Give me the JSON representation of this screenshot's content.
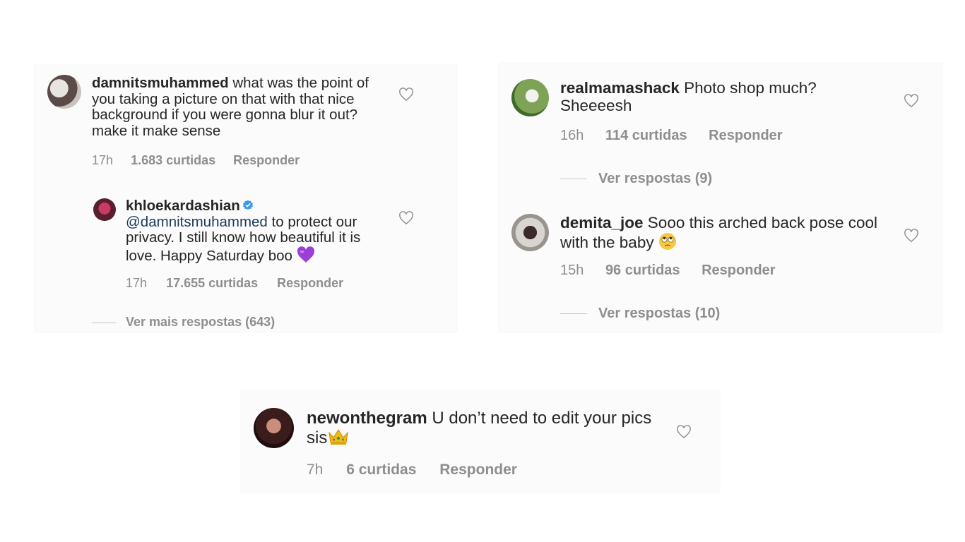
{
  "comments": {
    "c1": {
      "username": "damnitsmuhammed",
      "text": " what was the point of you taking a picture on that with that nice background if you were gonna blur it out? make it make sense",
      "time": "17h",
      "likes": "1.683 curtidas",
      "reply": "Responder"
    },
    "c1_reply": {
      "username": "khloekardashian",
      "verified": true,
      "mention": "@damnitsmuhammed",
      "text": " to protect our privacy. I still know how beautiful it is love. Happy Saturday boo ",
      "emoji": "purple-heart",
      "time": "17h",
      "likes": "17.655 curtidas",
      "reply": "Responder"
    },
    "c1_more": "Ver mais respostas (643)",
    "c2": {
      "username": "realmamashack",
      "text": " Photo shop much? Sheeeesh",
      "time": "16h",
      "likes": "114 curtidas",
      "reply": "Responder",
      "more": "Ver respostas (9)"
    },
    "c3": {
      "username": "demita_joe",
      "text": " Sooo this arched back pose cool with the baby ",
      "emoji": "eye-roll-face",
      "time": "15h",
      "likes": "96 curtidas",
      "reply": "Responder",
      "more": "Ver respostas (10)"
    },
    "c4": {
      "username": "newonthegram",
      "text": " U don’t need to edit your pics sis",
      "emoji": "crown",
      "time": "7h",
      "likes": "6 curtidas",
      "reply": "Responder"
    }
  },
  "colors": {
    "text": "#262626",
    "meta": "#8e8e8e",
    "mention": "#1c3a5e",
    "verified": "#3897f0",
    "panel": "#fbfbfb"
  }
}
